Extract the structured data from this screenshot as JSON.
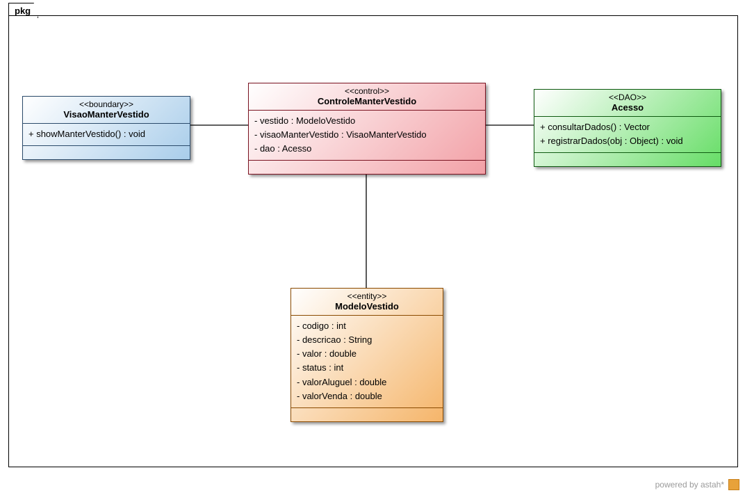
{
  "package_name": "pkg",
  "footer": "powered by astah*",
  "classes": {
    "boundary": {
      "stereotype": "<<boundary>>",
      "name": "VisaoManterVestido",
      "ops": [
        "+ showManterVestido() : void"
      ]
    },
    "control": {
      "stereotype": "<<control>>",
      "name": "ControleManterVestido",
      "attrs": [
        "- vestido : ModeloVestido",
        "- visaoManterVestido : VisaoManterVestido",
        "- dao : Acesso"
      ]
    },
    "dao": {
      "stereotype": "<<DAO>>",
      "name": "Acesso",
      "ops": [
        "+ consultarDados() : Vector",
        "+ registrarDados(obj : Object) : void"
      ]
    },
    "entity": {
      "stereotype": "<<entity>>",
      "name": "ModeloVestido",
      "attrs": [
        "- codigo : int",
        "- descricao : String",
        "- valor : double",
        "- status : int",
        "- valorAluguel : double",
        "- valorVenda : double"
      ]
    }
  },
  "chart_data": {
    "type": "uml_class_diagram",
    "package": "pkg",
    "classes": [
      {
        "name": "VisaoManterVestido",
        "stereotype": "boundary",
        "attributes": [],
        "operations": [
          "+ showManterVestido() : void"
        ]
      },
      {
        "name": "ControleManterVestido",
        "stereotype": "control",
        "attributes": [
          "- vestido : ModeloVestido",
          "- visaoManterVestido : VisaoManterVestido",
          "- dao : Acesso"
        ],
        "operations": []
      },
      {
        "name": "Acesso",
        "stereotype": "DAO",
        "attributes": [],
        "operations": [
          "+ consultarDados() : Vector",
          "+ registrarDados(obj : Object) : void"
        ]
      },
      {
        "name": "ModeloVestido",
        "stereotype": "entity",
        "attributes": [
          "- codigo : int",
          "- descricao : String",
          "- valor : double",
          "- status : int",
          "- valorAluguel : double",
          "- valorVenda : double"
        ],
        "operations": []
      }
    ],
    "associations": [
      {
        "from": "VisaoManterVestido",
        "to": "ControleManterVestido"
      },
      {
        "from": "ControleManterVestido",
        "to": "Acesso"
      },
      {
        "from": "ControleManterVestido",
        "to": "ModeloVestido"
      }
    ]
  }
}
